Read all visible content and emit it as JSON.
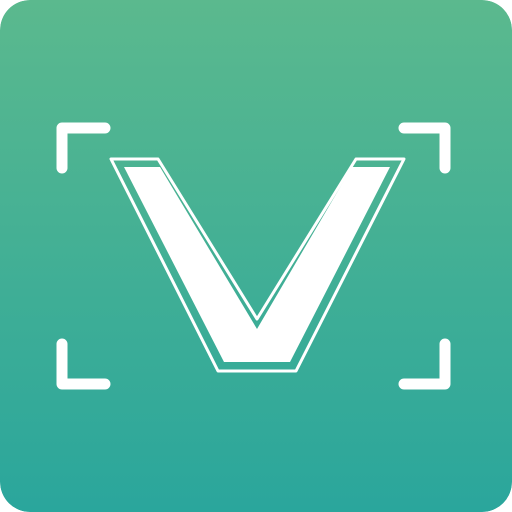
{
  "icon": {
    "name": "viewfinder-v-logo",
    "letter": "V",
    "colors": {
      "gradient_top": "#5bb98e",
      "gradient_bottom": "#2aa69c",
      "foreground": "#ffffff"
    }
  }
}
